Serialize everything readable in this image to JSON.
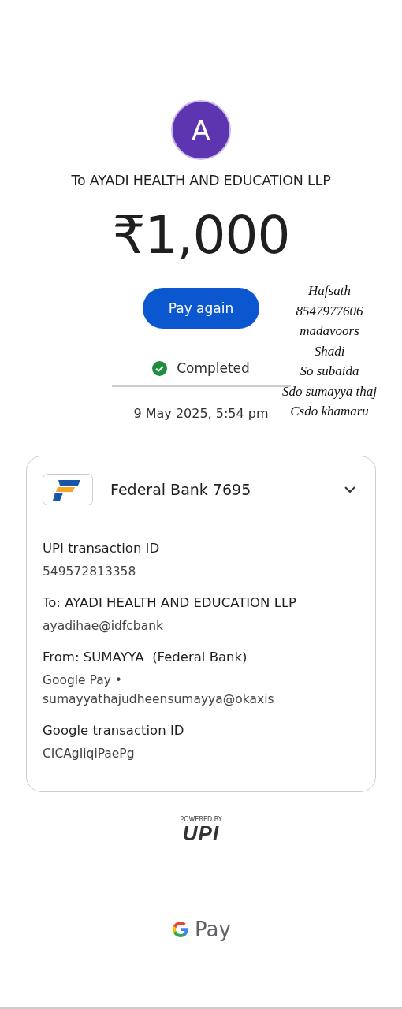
{
  "avatar": {
    "initial": "A"
  },
  "recipient": "To AYADI HEALTH AND EDUCATION LLP",
  "amount": "₹1,000",
  "action_button": "Pay again",
  "status": {
    "label": "Completed",
    "completed": true
  },
  "date": "9 May 2025, 5:54 pm",
  "handwritten_note": [
    "Hafsath",
    "8547977606",
    "madavoors",
    "Shadi",
    "So subaida",
    "Sdo sumayya thaj",
    "Csdo khamaru"
  ],
  "account_card": {
    "bank": "Federal Bank 7695",
    "expanded": true,
    "details": [
      {
        "label": "UPI transaction ID",
        "value": "549572813358"
      },
      {
        "label": "To: AYADI HEALTH AND EDUCATION LLP",
        "value": "ayadihae@idfcbank"
      },
      {
        "label": "From: SUMAYYA  (Federal Bank)",
        "value": "Google Pay • sumayyathajudheensumayya@okaxis"
      },
      {
        "label": "Google transaction ID",
        "value": "CICAgIiqiPaePg"
      }
    ]
  },
  "footer": {
    "powered_by": "POWERED BY",
    "upi": "UPI",
    "brand": "Pay"
  }
}
